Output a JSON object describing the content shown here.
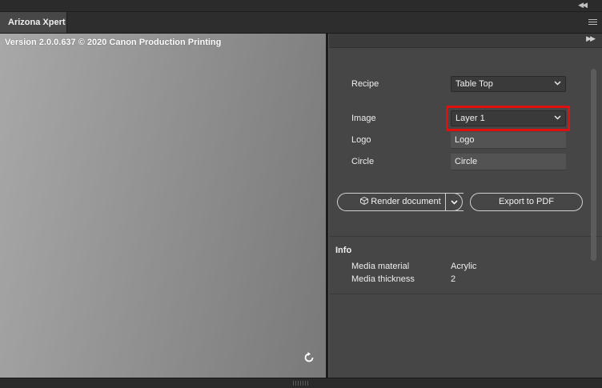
{
  "window": {
    "tab_title": "Arizona Xpert",
    "collapse_icon": "double-chevron-left-icon",
    "close_icon": "close-icon",
    "menu_icon": "hamburger-menu-icon"
  },
  "preview": {
    "version_text": "Version 2.0.0.637 © 2020 Canon Production Printing",
    "refresh_icon": "refresh-icon"
  },
  "settings": {
    "recipe": {
      "label": "Recipe",
      "value": "Table Top"
    },
    "image": {
      "label": "Image",
      "value": "Layer 1"
    },
    "logo": {
      "label": "Logo",
      "value": "Logo"
    },
    "circle": {
      "label": "Circle",
      "value": "Circle"
    }
  },
  "actions": {
    "render_label": "Render document",
    "export_label": "Export to PDF"
  },
  "info": {
    "title": "Info",
    "rows": [
      {
        "label": "Media material",
        "value": "Acrylic"
      },
      {
        "label": "Media thickness",
        "value": "2"
      }
    ]
  },
  "colors": {
    "highlight": "#e01010",
    "panel_bg": "#464646"
  }
}
